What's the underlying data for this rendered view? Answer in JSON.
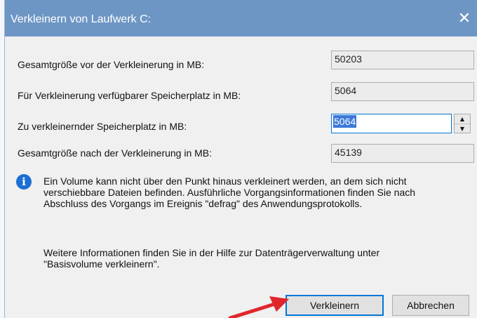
{
  "dialog": {
    "title": "Verkleinern von Laufwerk C:",
    "close_glyph": "✕"
  },
  "fields": {
    "total_before_label": "Gesamtgröße vor der Verkleinerung in MB:",
    "total_before_value": "50203",
    "available_label": "Für Verkleinerung verfügbarer Speicherplatz in MB:",
    "available_value": "5064",
    "shrink_label": "Zu verkleinernder Speicherplatz in MB:",
    "shrink_value": "5064",
    "total_after_label": "Gesamtgröße nach der Verkleinerung in MB:",
    "total_after_value": "45139"
  },
  "info": {
    "icon": "info-icon",
    "lines": [
      "Ein Volume kann nicht über den Punkt hinaus verkleinert werden, an dem sich nicht",
      "verschiebbare Dateien befinden. Ausführliche Vorgangsinformationen finden Sie nach",
      "Abschluss des Vorgangs im Ereignis \"defrag\" des Anwendungsprotokolls."
    ],
    "help_lines": [
      "Weitere Informationen finden Sie in der Hilfe zur Datenträgerverwaltung unter",
      "\"Basisvolume verkleinern\"."
    ]
  },
  "buttons": {
    "shrink": "Verkleinern",
    "cancel": "Abbrechen"
  },
  "colors": {
    "titlebar": "#6e96c4",
    "accent": "#0078d7",
    "annotation_arrow": "#e0262b"
  }
}
